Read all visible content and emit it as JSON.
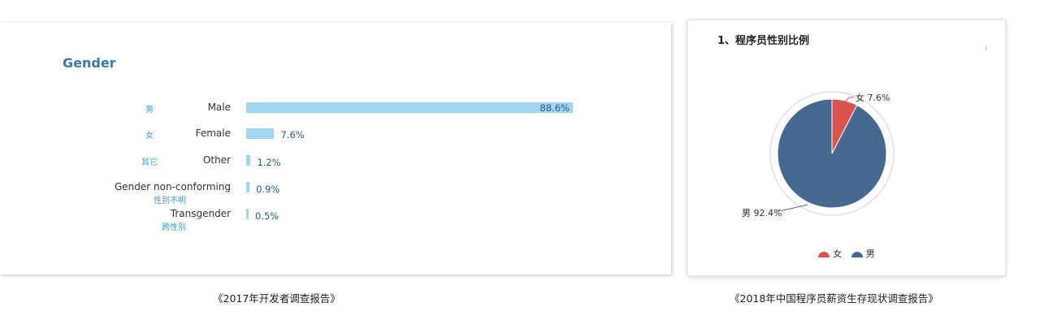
{
  "left_chart": {
    "title": "Gender",
    "rows": [
      {
        "en": "Male",
        "cn": "男",
        "value": 88.6,
        "value_label": "88.6%"
      },
      {
        "en": "Female",
        "cn": "女",
        "value": 7.6,
        "value_label": "7.6%"
      },
      {
        "en": "Other",
        "cn": "其它",
        "value": 1.2,
        "value_label": "1.2%"
      },
      {
        "en": "Gender non-conforming",
        "cn": "性别不明",
        "value": 0.9,
        "value_label": "0.9%"
      },
      {
        "en": "Transgender",
        "cn": "跨性别",
        "value": 0.5,
        "value_label": "0.5%"
      }
    ],
    "bar_color": "#a4d4f4",
    "caption": "《2017年开发者调查报告》"
  },
  "right_chart": {
    "title": "1、程序员性别比例",
    "info_icon": "i",
    "slices": [
      {
        "name": "女",
        "value": 7.6,
        "label": "女 7.6%",
        "color": "#d9534f"
      },
      {
        "name": "男",
        "value": 92.4,
        "label": "男 92.4%",
        "color": "#466a8f"
      }
    ],
    "legend": [
      "女",
      "男"
    ],
    "caption": "《2018年中国程序员薪资生存现状调查报告》"
  },
  "chart_data": [
    {
      "type": "bar",
      "title": "Gender",
      "categories": [
        "Male",
        "Female",
        "Other",
        "Gender non-conforming",
        "Transgender"
      ],
      "values": [
        88.6,
        7.6,
        1.2,
        0.9,
        0.5
      ]
    },
    {
      "type": "pie",
      "title": "1、程序员性别比例",
      "categories": [
        "女",
        "男"
      ],
      "values": [
        7.6,
        92.4
      ],
      "legend": "bottom"
    }
  ]
}
